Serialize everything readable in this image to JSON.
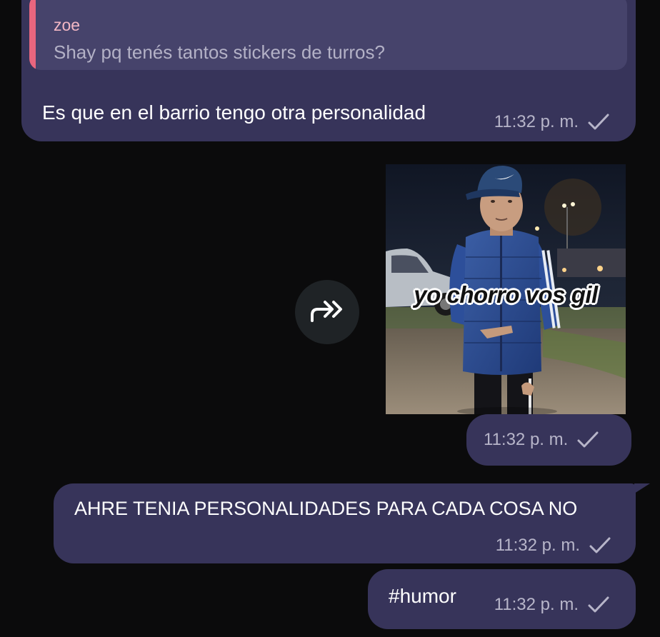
{
  "messages": [
    {
      "reply": {
        "author": "zoe",
        "text": "Shay pq tenés tantos stickers de turros?"
      },
      "text": "Es que en el barrio tengo otra personalidad",
      "time": "11:32 p. m."
    },
    {
      "sticker": {
        "caption": "yo chorro vos gil"
      },
      "time": "11:32 p. m."
    },
    {
      "text": "AHRE TENIA PERSONALIDADES PARA CADA COSA NO",
      "time": "11:32 p. m."
    },
    {
      "text": "#humor",
      "time": "11:32 p. m."
    }
  ],
  "icons": {
    "forward": "forward-icon",
    "sent": "check-icon"
  },
  "colors": {
    "background": "#0b0b0c",
    "bubble": "#37345a",
    "quote_background": "#46436b",
    "quote_bar": "#e8667e",
    "quote_author": "#f2b7c4",
    "meta_text": "#b7b5c9"
  }
}
